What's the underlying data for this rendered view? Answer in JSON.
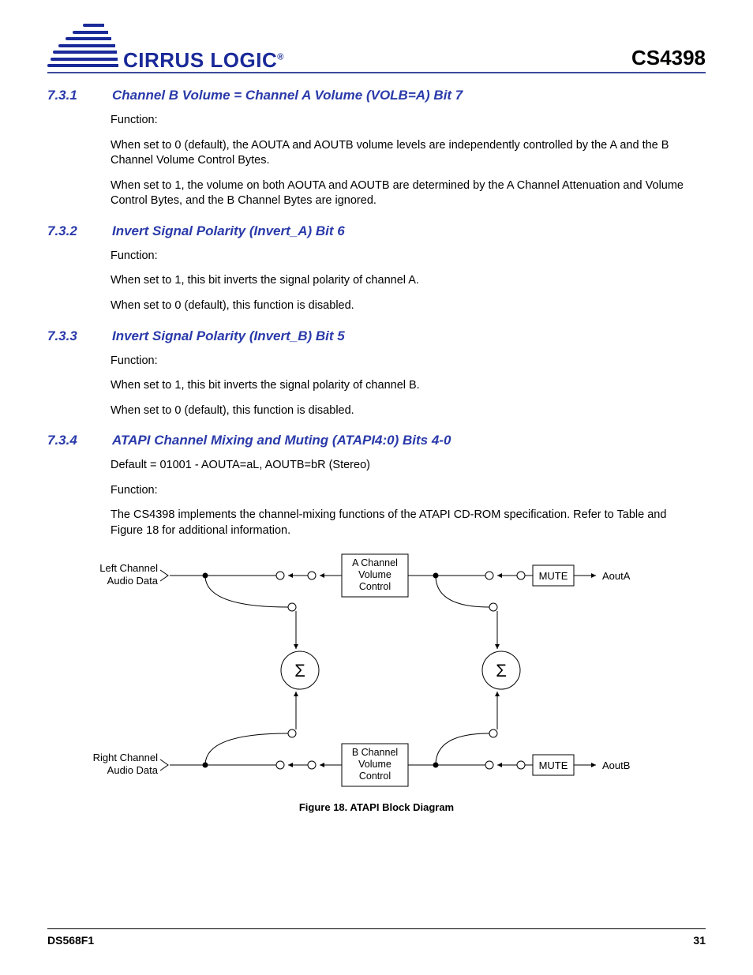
{
  "header": {
    "brand": "CIRRUS LOGIC",
    "reg": "®",
    "part": "CS4398"
  },
  "sections": [
    {
      "num": "7.3.1",
      "title": "Channel B Volume = Channel A Volume (VOLB=A) Bit 7",
      "func": "Function:",
      "paras": [
        "When set to 0 (default), the AOUTA and AOUTB volume levels are independently controlled by the A and the B Channel Volume Control Bytes.",
        "When set to 1, the volume on both AOUTA and AOUTB are determined by the A Channel Attenuation and Volume Control Bytes, and the B Channel Bytes are ignored."
      ]
    },
    {
      "num": "7.3.2",
      "title": "Invert Signal Polarity (Invert_A) Bit 6",
      "func": "Function:",
      "paras": [
        "When set to 1, this bit inverts the signal polarity of channel A.",
        "When set to 0 (default), this function is disabled."
      ]
    },
    {
      "num": "7.3.3",
      "title": "Invert Signal Polarity (Invert_B) Bit 5",
      "func": "Function:",
      "paras": [
        "When set to 1, this bit inverts the signal polarity of channel B.",
        "When set to 0 (default), this function is disabled."
      ]
    },
    {
      "num": "7.3.4",
      "title": "ATAPI Channel Mixing and Muting (ATAPI4:0) Bits 4-0",
      "func": "Function:",
      "default": "Default = 01001 - AOUTA=aL, AOUTB=bR (Stereo)",
      "paras": [
        "The CS4398 implements the channel-mixing functions of the ATAPI CD-ROM specification. Refer to Table  and Figure 18 for additional information."
      ]
    }
  ],
  "diagram": {
    "left_top": "Left Channel",
    "left_top2": "Audio Data",
    "left_bot": "Right Channel",
    "left_bot2": "Audio Data",
    "a_vol1": "A Channel",
    "a_vol2": "Volume",
    "a_vol3": "Control",
    "b_vol1": "B Channel",
    "b_vol2": "Volume",
    "b_vol3": "Control",
    "mute": "MUTE",
    "out_a": "AoutA",
    "out_b": "AoutB",
    "sigma": "Σ",
    "caption": "Figure 18.  ATAPI Block Diagram"
  },
  "footer": {
    "doc": "DS568F1",
    "page": "31"
  }
}
